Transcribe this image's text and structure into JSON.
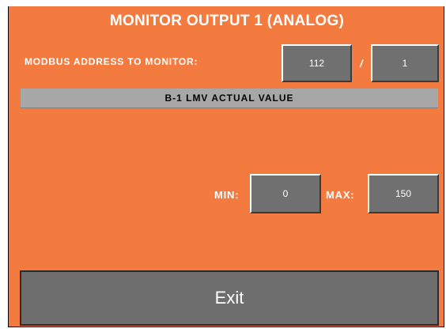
{
  "screen": {
    "background_color": "#f47b3f",
    "title": "MONITOR OUTPUT 1 (ANALOG)"
  },
  "modbus": {
    "label": "MODBUS ADDRESS TO MONITOR:",
    "address_value": "112",
    "separator": "/",
    "sub_value": "1"
  },
  "actual_value": {
    "label": "B-1 LMV ACTUAL VALUE"
  },
  "range": {
    "min_label": "MIN:",
    "min_value": "0",
    "max_label": "MAX:",
    "max_value": "150"
  },
  "exit_button": {
    "label": "Exit"
  }
}
